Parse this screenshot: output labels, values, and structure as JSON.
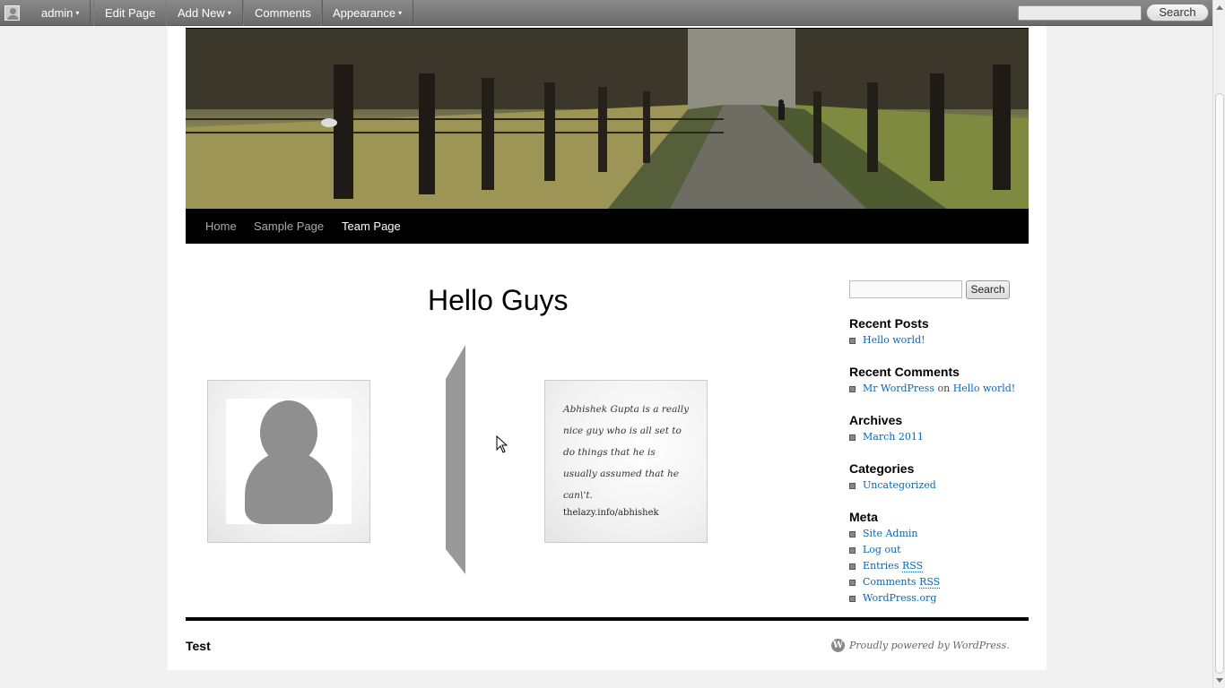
{
  "adminbar": {
    "user": "admin",
    "edit_page": "Edit Page",
    "add_new": "Add New",
    "comments": "Comments",
    "appearance": "Appearance",
    "caret": "▾",
    "search_button": "Search"
  },
  "nav": {
    "items": [
      "Home",
      "Sample Page",
      "Team Page"
    ],
    "current": "Team Page"
  },
  "content": {
    "title": "Hello Guys",
    "bio": "Abhishek Gupta is a really nice guy who is all set to do things that he is usually assumed that he can\\'t.",
    "link": "thelazy.info/abhishek"
  },
  "sidebar": {
    "search_button": "Search",
    "recent_posts": {
      "title": "Recent Posts",
      "items": [
        "Hello world!"
      ]
    },
    "recent_comments": {
      "title": "Recent Comments",
      "author": "Mr WordPress",
      "on": "on",
      "post": "Hello world!"
    },
    "archives": {
      "title": "Archives",
      "items": [
        "March 2011"
      ]
    },
    "categories": {
      "title": "Categories",
      "items": [
        "Uncategorized"
      ]
    },
    "meta": {
      "title": "Meta",
      "site_admin": "Site Admin",
      "log_out": "Log out",
      "entries": "Entries",
      "comments": "Comments",
      "rss": "RSS",
      "wordpress_org": "WordPress.org"
    }
  },
  "footer": {
    "site_title": "Test",
    "credit": "Proudly powered by WordPress.",
    "wp_logo": "W"
  },
  "colors": {
    "link": "#0066cc",
    "nav_bg": "#000000",
    "page_bg": "#f1f1f1"
  }
}
